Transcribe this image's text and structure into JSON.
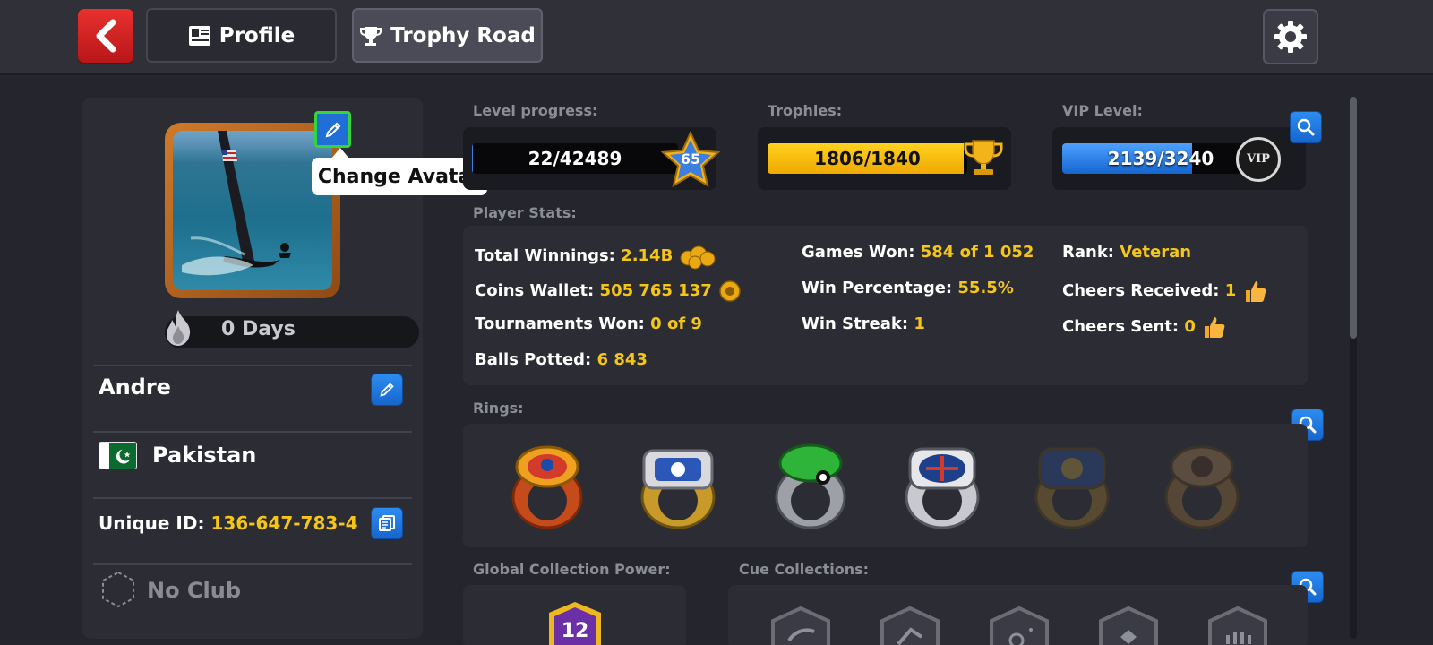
{
  "header": {
    "tabs": [
      {
        "label": "Profile",
        "icon": "profile-card-icon"
      },
      {
        "label": "Trophy Road",
        "icon": "trophy-icon"
      }
    ]
  },
  "profile": {
    "tooltip": "Change Avatar",
    "streak": "0 Days",
    "name": "Andre",
    "country": "Pakistan",
    "unique_id_label": "Unique ID:",
    "unique_id": "136-647-783-4",
    "club": "No Club"
  },
  "progress": {
    "level_label": "Level progress:",
    "level_value": "22/42489",
    "level_fraction": 0.0005,
    "level_badge": "65",
    "trophies_label": "Trophies:",
    "trophies_value": "1806/1840",
    "trophies_fraction": 0.98,
    "vip_label": "VIP Level:",
    "vip_value": "2139/3240",
    "vip_fraction": 0.66,
    "vip_badge": "VIP"
  },
  "stats": {
    "label": "Player Stats:",
    "items": [
      {
        "label": "Total Winnings:",
        "value": "2.14B"
      },
      {
        "label": "Coins Wallet:",
        "value": "505 765 137"
      },
      {
        "label": "Tournaments Won:",
        "value": "0 of 9"
      },
      {
        "label": "Balls Potted:",
        "value": "6 843"
      },
      {
        "label": "Games Won:",
        "value": "584 of 1 052"
      },
      {
        "label": "Win Percentage:",
        "value": "55.5%"
      },
      {
        "label": "Win Streak:",
        "value": "1"
      },
      {
        "label": "Rank:",
        "value": "Veteran"
      },
      {
        "label": "Cheers Received:",
        "value": "1"
      },
      {
        "label": "Cheers Sent:",
        "value": "0"
      }
    ]
  },
  "rings": {
    "label": "Rings:"
  },
  "collections": {
    "global_label": "Global Collection Power:",
    "global_value": "12",
    "cue_label": "Cue Collections:"
  },
  "colors": {
    "accent_yellow": "#f5c518",
    "trophy_bar": "#f5b800",
    "vip_bar": "#1e7be0",
    "back_red": "#d8242a",
    "edit_blue": "#1f6fd6"
  }
}
